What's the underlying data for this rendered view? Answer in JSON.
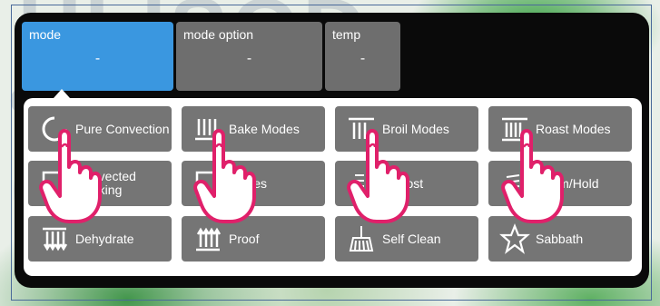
{
  "tabs": [
    {
      "label": "mode",
      "value": "-"
    },
    {
      "label": "mode option",
      "value": "-"
    },
    {
      "label": "temp",
      "value": "-"
    }
  ],
  "buttons": [
    {
      "label": "Pure Convection",
      "icon": "fan-circle-icon"
    },
    {
      "label": "Bake Modes",
      "icon": "bake-elements-icon"
    },
    {
      "label": "Broil Modes",
      "icon": "broil-elements-icon"
    },
    {
      "label": "Roast Modes",
      "icon": "roast-elements-icon"
    },
    {
      "label": "Convected Cooking",
      "icon": "convection-icon"
    },
    {
      "label": "Modes",
      "icon": "modes-icon"
    },
    {
      "label": "Defrost",
      "icon": "defrost-icon"
    },
    {
      "label": "Warm/Hold",
      "icon": "warm-hold-icon"
    },
    {
      "label": "Dehydrate",
      "icon": "dehydrate-icon"
    },
    {
      "label": "Proof",
      "icon": "proof-icon"
    },
    {
      "label": "Self Clean",
      "icon": "broom-icon"
    },
    {
      "label": "Sabbath",
      "icon": "star-icon"
    }
  ],
  "colors": {
    "panel": "#0a0a0a",
    "tab_active": "#3a97e0",
    "tab_inactive": "#6e6e6e",
    "button": "#757575",
    "hand_outline": "#e0206a"
  },
  "overlay": {
    "icon": "tap-hand-icon"
  }
}
